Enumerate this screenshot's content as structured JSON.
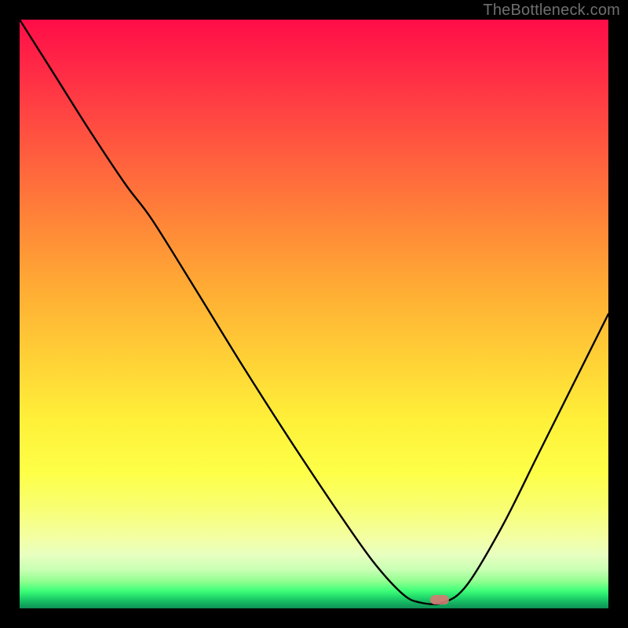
{
  "watermark": {
    "text": "TheBottleneck.com"
  },
  "marker": {
    "color": "#d77a74",
    "x_fraction": 0.713,
    "y_fraction": 0.985
  },
  "chart_data": {
    "type": "line",
    "title": "",
    "xlabel": "",
    "ylabel": "",
    "xlim": [
      0,
      1
    ],
    "ylim": [
      0,
      1
    ],
    "grid": false,
    "legend": false,
    "note": "Axes are unlabeled; x and y are normalized fractions of the plot area. y=1 is top (worst), y≈0 is bottom (best/green). Curve descends from top-left to a minimum near x≈0.70 then rises toward the right edge.",
    "series": [
      {
        "name": "bottleneck-curve",
        "x": [
          0.0,
          0.06,
          0.12,
          0.18,
          0.225,
          0.3,
          0.38,
          0.46,
          0.54,
          0.6,
          0.65,
          0.68,
          0.72,
          0.76,
          0.82,
          0.88,
          0.94,
          1.0
        ],
        "y": [
          1.0,
          0.905,
          0.81,
          0.72,
          0.66,
          0.54,
          0.41,
          0.285,
          0.165,
          0.08,
          0.025,
          0.01,
          0.01,
          0.04,
          0.14,
          0.26,
          0.38,
          0.5
        ]
      }
    ],
    "marker_point": {
      "x": 0.713,
      "y": 0.012
    }
  }
}
